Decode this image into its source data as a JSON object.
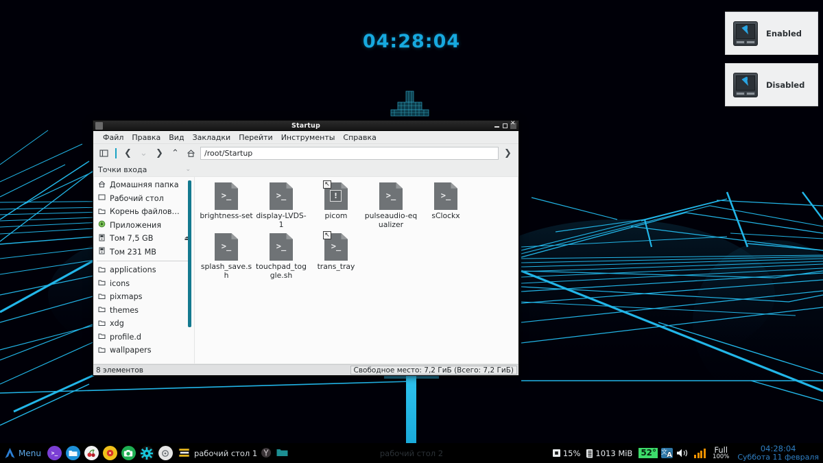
{
  "desktop": {
    "conky_clock": "04:28:04",
    "accent_cyan": "#17a9df",
    "wallpaper_line_color": "#22b6e8",
    "background": "#000010"
  },
  "notifications": [
    {
      "icon": "touchpad-icon",
      "text": "Enabled"
    },
    {
      "icon": "touchpad-icon",
      "text": "Disabled"
    }
  ],
  "file_manager": {
    "title": "Startup",
    "window_buttons": {
      "minimize": "minimize-icon",
      "maximize": "maximize-icon",
      "close": "close-icon"
    },
    "menu": [
      "Файл",
      "Правка",
      "Вид",
      "Закладки",
      "Перейти",
      "Инструменты",
      "Справка"
    ],
    "toolbar": {
      "sidebar_toggle": "sidebar-toggle-icon",
      "back": "❮",
      "history": "⌄",
      "forward": "❯",
      "up": "⌃",
      "home": "home-icon",
      "go": "❯"
    },
    "path": "/root/Startup",
    "sidebar": {
      "header": "Точки входа",
      "places": [
        {
          "label": "Домашняя папка",
          "icon": "home-icon"
        },
        {
          "label": "Рабочий стол",
          "icon": "desktop-icon"
        },
        {
          "label": "Корень файлов…",
          "icon": "folder-icon"
        },
        {
          "label": "Приложения",
          "icon": "applications-icon"
        },
        {
          "label": "Том 7,5 GB",
          "icon": "drive-icon",
          "eject": true
        },
        {
          "label": "Том 231 MB",
          "icon": "drive-icon"
        }
      ],
      "bookmarks": [
        {
          "label": "applications",
          "icon": "folder-icon"
        },
        {
          "label": "icons",
          "icon": "folder-icon"
        },
        {
          "label": "pixmaps",
          "icon": "folder-icon"
        },
        {
          "label": "themes",
          "icon": "folder-icon"
        },
        {
          "label": "xdg",
          "icon": "folder-icon"
        },
        {
          "label": "profile.d",
          "icon": "folder-icon"
        },
        {
          "label": "wallpapers",
          "icon": "folder-icon"
        }
      ]
    },
    "files": [
      {
        "name": "brightness-set",
        "kind": "script",
        "glyph": ">_",
        "symlink": false
      },
      {
        "name": "display-LVDS-1",
        "kind": "script",
        "glyph": ">_",
        "symlink": false
      },
      {
        "name": "picom",
        "kind": "config",
        "glyph": "!",
        "symlink": true
      },
      {
        "name": "pulseaudio-equalizer",
        "kind": "script",
        "glyph": ">_",
        "symlink": false
      },
      {
        "name": "sClockx",
        "kind": "script",
        "glyph": ">_",
        "symlink": false
      },
      {
        "name": "splash_save.sh",
        "kind": "script",
        "glyph": ">_",
        "symlink": false
      },
      {
        "name": "touchpad_toggle.sh",
        "kind": "script",
        "glyph": ">_",
        "symlink": false
      },
      {
        "name": "trans_tray",
        "kind": "script",
        "glyph": ">_",
        "symlink": true
      }
    ],
    "status": {
      "count": "8 элементов",
      "free_space": "Свободное место: 7,2 ГиБ (Всего: 7,2 ГиБ)"
    }
  },
  "panel": {
    "menu_label": "Menu",
    "launchers": [
      {
        "name": "terminal-launcher",
        "glyph": ">_",
        "color": "#7b3fd4"
      },
      {
        "name": "file-manager-launcher",
        "glyph": "⬜",
        "color": "#1e90d8"
      },
      {
        "name": "cherrytree-launcher",
        "glyph": "❦",
        "color": "#f2f2f2"
      },
      {
        "name": "media-launcher",
        "glyph": "●",
        "color": "#f0c01a"
      },
      {
        "name": "screenshot-launcher",
        "glyph": "▣",
        "color": "#1eae52"
      },
      {
        "name": "settings-launcher",
        "glyph": "⚙",
        "color": "#18c3d6"
      },
      {
        "name": "gear-launcher",
        "glyph": "⚙",
        "color": "#e6e6e6"
      }
    ],
    "task": {
      "icon": "window-stack-icon",
      "label": "рабочий стол 1"
    },
    "tray": [
      {
        "name": "yandex-tray-icon",
        "glyph": "Y"
      },
      {
        "name": "folder-tray-icon",
        "glyph": "▬"
      }
    ],
    "desktop_center_label": "рабочий стол 2",
    "cpu": {
      "icon": "cpu-icon",
      "value": "15%"
    },
    "ram": {
      "icon": "ram-icon",
      "value": "1013 MiB"
    },
    "temperature": "52°",
    "keyboard_layout": {
      "icon": "keyboard-layout-icon",
      "value": "A"
    },
    "volume": {
      "icon": "volume-icon"
    },
    "signal": {
      "icon": "signal-icon",
      "bars": 3
    },
    "battery": {
      "state": "Full",
      "percent": "100%"
    },
    "clock": {
      "time": "04:28:04",
      "date": "Суббота 11 февраля"
    },
    "clock_color": "#2f7fc4"
  }
}
